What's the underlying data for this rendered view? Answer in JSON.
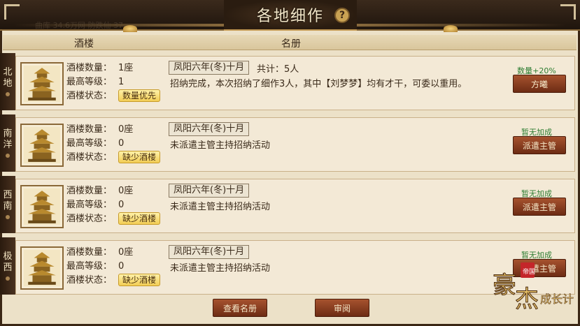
{
  "title": "各地细作",
  "header": {
    "col_tavern": "酒楼",
    "col_roster": "名册"
  },
  "background_text": "曲库 34.6万网 防跌仙 37",
  "labels": {
    "count": "酒楼数量：",
    "level": "最高等级：",
    "status": "酒楼状态："
  },
  "regions": [
    {
      "name_line1": "北",
      "name_line2": "地",
      "count": "1座",
      "level": "1",
      "status": "数量优先",
      "date": "凤阳六年(冬)十月",
      "total": "共计：5人",
      "desc": "招纳完成，本次招纳了细作3人，其中【刘梦梦】均有才干，可委以重用。",
      "bonus": "数量+20%",
      "bonus_color": "#2e7d32",
      "action": "方曦"
    },
    {
      "name_line1": "南",
      "name_line2": "洋",
      "count": "0座",
      "level": "0",
      "status": "缺少酒楼",
      "date": "凤阳六年(冬)十月",
      "total": "",
      "desc": "未派遣主管主持招纳活动",
      "bonus": "暂无加成",
      "bonus_color": "#2e7d32",
      "action": "派遣主管"
    },
    {
      "name_line1": "西",
      "name_line2": "南",
      "count": "0座",
      "level": "0",
      "status": "缺少酒楼",
      "date": "凤阳六年(冬)十月",
      "total": "",
      "desc": "未派遣主管主持招纳活动",
      "bonus": "暂无加成",
      "bonus_color": "#2e7d32",
      "action": "派遣主管"
    },
    {
      "name_line1": "极",
      "name_line2": "西",
      "count": "0座",
      "level": "0",
      "status": "缺少酒楼",
      "date": "凤阳六年(冬)十月",
      "total": "",
      "desc": "未派遣主管主持招纳活动",
      "bonus": "暂无加成",
      "bonus_color": "#2e7d32",
      "action": "派遣主管"
    }
  ],
  "buttons": {
    "view_roster": "查看名册",
    "review": "审阅"
  },
  "logo": {
    "text": "豪杰成长计划",
    "seal": "帝国"
  }
}
